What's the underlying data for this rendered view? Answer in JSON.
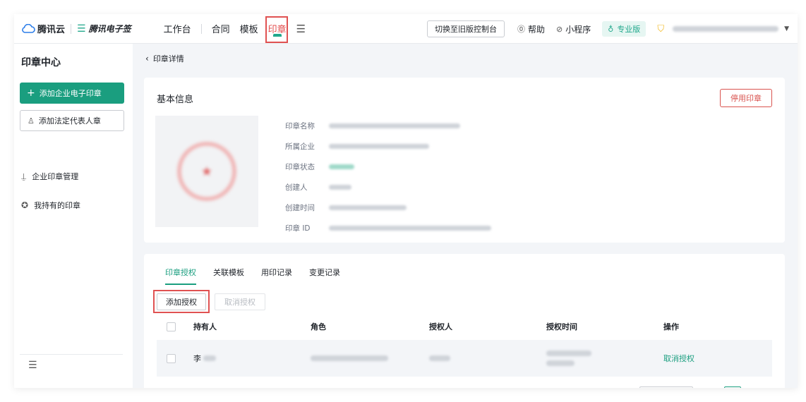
{
  "brand": {
    "cloud_name": "腾讯云",
    "esign_name": "腾讯电子签"
  },
  "nav": {
    "items": [
      "工作台",
      "合同",
      "模板",
      "印章"
    ],
    "active": "印章"
  },
  "toolbar": {
    "switch_label": "切换至旧版控制台",
    "help_label": "帮助",
    "miniprogram_label": "小程序",
    "edition_label": "专业版"
  },
  "sidebar": {
    "title": "印章中心",
    "add_enterprise_seal": "添加企业电子印章",
    "add_legal_seal": "添加法定代表人章",
    "items": [
      "企业印章管理",
      "我持有的印章"
    ]
  },
  "page": {
    "back_label": "印章详情"
  },
  "basic_info": {
    "title": "基本信息",
    "stop_button": "停用印章",
    "fields": [
      "印章名称",
      "所属企业",
      "印章状态",
      "创建人",
      "创建时间",
      "印章 ID"
    ]
  },
  "tabs": [
    "印章授权",
    "关联模板",
    "用印记录",
    "变更记录"
  ],
  "actions": {
    "add_auth": "添加授权",
    "cancel_auth": "取消授权"
  },
  "table": {
    "headers": [
      "持有人",
      "角色",
      "授权人",
      "授权时间",
      "操作"
    ],
    "rows": [
      {
        "holder_prefix": "李",
        "action": "取消授权"
      }
    ]
  },
  "colors": {
    "brand_green": "#1a9e7f",
    "danger_red": "#d9534f",
    "highlight_red": "#e05252"
  }
}
